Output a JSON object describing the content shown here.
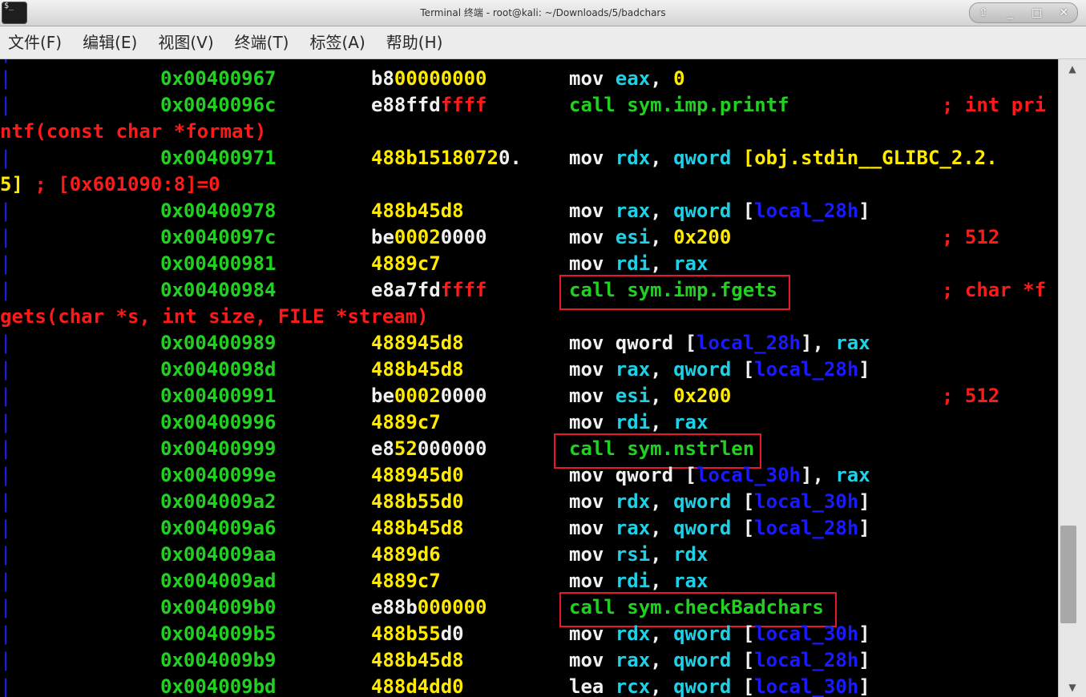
{
  "window": {
    "title": "Terminal 终端 - root@kali: ~/Downloads/5/badchars",
    "icon_label": "$_",
    "controls": [
      "⇧",
      "_",
      "□",
      "✕"
    ]
  },
  "menu": [
    "文件(F)",
    "编辑(E)",
    "视图(V)",
    "终端(T)",
    "标签(A)",
    "帮助(H)"
  ],
  "terminal": {
    "top_fragment": ".",
    "rows": [
      {
        "addr": "0x00400967",
        "bytes": [
          [
            "b8",
            "w"
          ],
          [
            "00000000",
            "y"
          ]
        ],
        "instr": [
          [
            "mov ",
            "w"
          ],
          [
            "eax",
            "c"
          ],
          [
            ", ",
            "w"
          ],
          [
            "0",
            "y"
          ]
        ],
        "comment": ""
      },
      {
        "addr": "0x0040096c",
        "bytes": [
          [
            "e88ffd",
            "w"
          ],
          [
            "ffff",
            "r"
          ]
        ],
        "instr": [
          [
            "call sym.imp.printf",
            "g"
          ]
        ],
        "comment": "; int pri",
        "cont": [
          [
            "ntf(const char *format)",
            "r"
          ]
        ]
      },
      {
        "addr": "0x00400971",
        "bytes": [
          [
            "488b1518072",
            "y"
          ],
          [
            "0.",
            "w"
          ]
        ],
        "instr": [
          [
            "mov ",
            "w"
          ],
          [
            "rdx",
            "c"
          ],
          [
            ", ",
            "w"
          ],
          [
            "qword",
            "c"
          ],
          [
            " [obj.stdin__GLIBC_2.2.",
            "y"
          ]
        ],
        "comment": "",
        "cont": [
          [
            "5]",
            "y"
          ],
          [
            " ; [0x601090:8]=0",
            "r"
          ]
        ]
      },
      {
        "addr": "0x00400978",
        "bytes": [
          [
            "488b45d8",
            "y"
          ]
        ],
        "instr": [
          [
            "mov ",
            "w"
          ],
          [
            "rax",
            "c"
          ],
          [
            ", ",
            "w"
          ],
          [
            "qword",
            "c"
          ],
          [
            " [",
            "w"
          ],
          [
            "local_28h",
            "b"
          ],
          [
            "]",
            "w"
          ]
        ],
        "comment": ""
      },
      {
        "addr": "0x0040097c",
        "bytes": [
          [
            "be",
            "w"
          ],
          [
            "0002",
            "y"
          ],
          [
            "0000",
            "w"
          ]
        ],
        "instr": [
          [
            "mov ",
            "w"
          ],
          [
            "esi",
            "c"
          ],
          [
            ", ",
            "w"
          ],
          [
            "0x200",
            "y"
          ]
        ],
        "comment": "; 512"
      },
      {
        "addr": "0x00400981",
        "bytes": [
          [
            "4889c7",
            "y"
          ]
        ],
        "instr": [
          [
            "mov ",
            "w"
          ],
          [
            "rdi",
            "c"
          ],
          [
            ", ",
            "w"
          ],
          [
            "rax",
            "c"
          ]
        ],
        "comment": ""
      },
      {
        "addr": "0x00400984",
        "bytes": [
          [
            "e8a7fd",
            "w"
          ],
          [
            "ffff",
            "r"
          ]
        ],
        "instr": [
          [
            "call sym.imp.fgets",
            "g"
          ]
        ],
        "comment": "; char *f",
        "cont": [
          [
            "gets(char *s, int size, FILE *stream)",
            "r"
          ]
        ]
      },
      {
        "addr": "0x00400989",
        "bytes": [
          [
            "488945d8",
            "y"
          ]
        ],
        "instr": [
          [
            "mov qword [",
            "w"
          ],
          [
            "local_28h",
            "b"
          ],
          [
            "], ",
            "w"
          ],
          [
            "rax",
            "c"
          ]
        ],
        "comment": ""
      },
      {
        "addr": "0x0040098d",
        "bytes": [
          [
            "488b45d8",
            "y"
          ]
        ],
        "instr": [
          [
            "mov ",
            "w"
          ],
          [
            "rax",
            "c"
          ],
          [
            ", ",
            "w"
          ],
          [
            "qword",
            "c"
          ],
          [
            " [",
            "w"
          ],
          [
            "local_28h",
            "b"
          ],
          [
            "]",
            "w"
          ]
        ],
        "comment": ""
      },
      {
        "addr": "0x00400991",
        "bytes": [
          [
            "be",
            "w"
          ],
          [
            "0002",
            "y"
          ],
          [
            "0000",
            "w"
          ]
        ],
        "instr": [
          [
            "mov ",
            "w"
          ],
          [
            "esi",
            "c"
          ],
          [
            ", ",
            "w"
          ],
          [
            "0x200",
            "y"
          ]
        ],
        "comment": "; 512"
      },
      {
        "addr": "0x00400996",
        "bytes": [
          [
            "4889c7",
            "y"
          ]
        ],
        "instr": [
          [
            "mov ",
            "w"
          ],
          [
            "rdi",
            "c"
          ],
          [
            ", ",
            "w"
          ],
          [
            "rax",
            "c"
          ]
        ],
        "comment": ""
      },
      {
        "addr": "0x00400999",
        "bytes": [
          [
            "e8",
            "w"
          ],
          [
            "52",
            "y"
          ],
          [
            "000000",
            "w"
          ]
        ],
        "instr": [
          [
            "call sym.nstrlen",
            "g"
          ]
        ],
        "comment": ""
      },
      {
        "addr": "0x0040099e",
        "bytes": [
          [
            "488945d0",
            "y"
          ]
        ],
        "instr": [
          [
            "mov qword [",
            "w"
          ],
          [
            "local_30h",
            "b"
          ],
          [
            "], ",
            "w"
          ],
          [
            "rax",
            "c"
          ]
        ],
        "comment": ""
      },
      {
        "addr": "0x004009a2",
        "bytes": [
          [
            "488b55d0",
            "y"
          ]
        ],
        "instr": [
          [
            "mov ",
            "w"
          ],
          [
            "rdx",
            "c"
          ],
          [
            ", ",
            "w"
          ],
          [
            "qword",
            "c"
          ],
          [
            " [",
            "w"
          ],
          [
            "local_30h",
            "b"
          ],
          [
            "]",
            "w"
          ]
        ],
        "comment": ""
      },
      {
        "addr": "0x004009a6",
        "bytes": [
          [
            "488b45d8",
            "y"
          ]
        ],
        "instr": [
          [
            "mov ",
            "w"
          ],
          [
            "rax",
            "c"
          ],
          [
            ", ",
            "w"
          ],
          [
            "qword",
            "c"
          ],
          [
            " [",
            "w"
          ],
          [
            "local_28h",
            "b"
          ],
          [
            "]",
            "w"
          ]
        ],
        "comment": ""
      },
      {
        "addr": "0x004009aa",
        "bytes": [
          [
            "4889d6",
            "y"
          ]
        ],
        "instr": [
          [
            "mov ",
            "w"
          ],
          [
            "rsi",
            "c"
          ],
          [
            ", ",
            "w"
          ],
          [
            "rdx",
            "c"
          ]
        ],
        "comment": ""
      },
      {
        "addr": "0x004009ad",
        "bytes": [
          [
            "4889c7",
            "y"
          ]
        ],
        "instr": [
          [
            "mov ",
            "w"
          ],
          [
            "rdi",
            "c"
          ],
          [
            ", ",
            "w"
          ],
          [
            "rax",
            "c"
          ]
        ],
        "comment": ""
      },
      {
        "addr": "0x004009b0",
        "bytes": [
          [
            "e88b",
            "w"
          ],
          [
            "000000",
            "y"
          ]
        ],
        "instr": [
          [
            "call sym.checkBadchars",
            "g"
          ]
        ],
        "comment": ""
      },
      {
        "addr": "0x004009b5",
        "bytes": [
          [
            "488b",
            "y"
          ],
          [
            "55",
            "y"
          ],
          [
            "d0",
            "w"
          ]
        ],
        "instr": [
          [
            "mov ",
            "w"
          ],
          [
            "rdx",
            "c"
          ],
          [
            ", ",
            "w"
          ],
          [
            "qword",
            "c"
          ],
          [
            " [",
            "w"
          ],
          [
            "local_30h",
            "b"
          ],
          [
            "]",
            "w"
          ]
        ],
        "comment": ""
      },
      {
        "addr": "0x004009b9",
        "bytes": [
          [
            "488b45d8",
            "y"
          ]
        ],
        "instr": [
          [
            "mov ",
            "w"
          ],
          [
            "rax",
            "c"
          ],
          [
            ", ",
            "w"
          ],
          [
            "qword",
            "c"
          ],
          [
            " [",
            "w"
          ],
          [
            "local_28h",
            "b"
          ],
          [
            "]",
            "w"
          ]
        ],
        "comment": ""
      },
      {
        "addr": "0x004009bd",
        "bytes": [
          [
            "488d4dd0",
            "y"
          ]
        ],
        "instr": [
          [
            "lea ",
            "w"
          ],
          [
            "rcx",
            "c"
          ],
          [
            ", ",
            "w"
          ],
          [
            "qword",
            "c"
          ],
          [
            " [",
            "w"
          ],
          [
            "local_30h",
            "b"
          ],
          [
            "]",
            "w"
          ]
        ],
        "comment": ""
      }
    ],
    "highlighted": [
      "call sym.imp.fgets",
      "call sym.nstrlen",
      "call sym.checkBadchars"
    ]
  },
  "colors": {
    "address": "#22d022",
    "comment": "#ff1a1a",
    "register": "#1fd1e6",
    "local_var": "#1a1aff",
    "immediate": "#ffea00",
    "highlight_box": "#e8182a"
  },
  "scrollbar": {
    "up_arrow": "▲",
    "down_arrow": "▼"
  }
}
